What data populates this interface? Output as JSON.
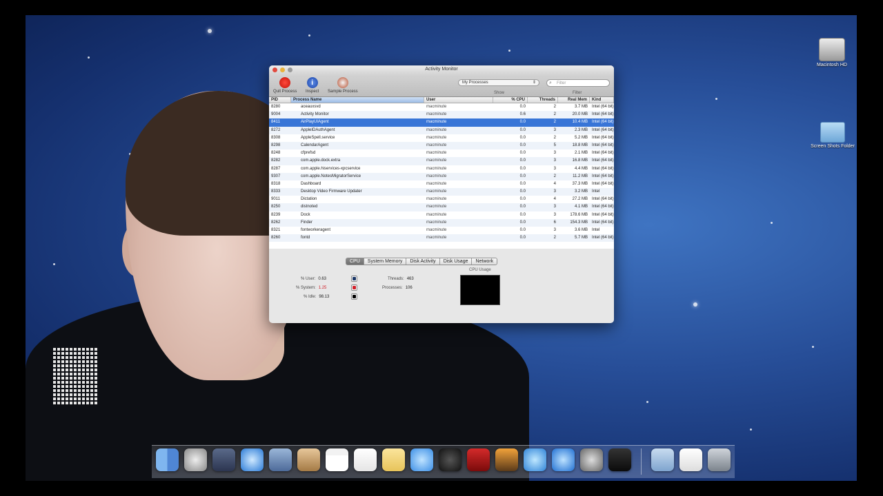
{
  "window": {
    "title": "Activity Monitor",
    "toolbar": {
      "quit_label": "Quit Process",
      "inspect_label": "Inspect",
      "sample_label": "Sample Process",
      "show_value": "My Processes",
      "show_caption": "Show",
      "filter_placeholder": "Filter",
      "filter_caption": "Filter"
    },
    "columns": [
      "PID",
      "Process Name",
      "User",
      "% CPU",
      "Threads",
      "Real Mem",
      "Kind"
    ],
    "rows": [
      {
        "pid": "8280",
        "name": "aceauxsvd",
        "user": "macminute",
        "cpu": "0.0",
        "threads": "2",
        "mem": "3.7 MB",
        "kind": "Intel (64 bit)"
      },
      {
        "pid": "9004",
        "name": "Activity Monitor",
        "user": "macminute",
        "cpu": "0.6",
        "threads": "2",
        "mem": "20.0 MB",
        "kind": "Intel (64 bit)"
      },
      {
        "pid": "8411",
        "name": "AirPlayUIAgent",
        "user": "macminute",
        "cpu": "0.0",
        "threads": "2",
        "mem": "10.4 MB",
        "kind": "Intel (64 bit)"
      },
      {
        "pid": "8272",
        "name": "AppleIDAuthAgent",
        "user": "macminute",
        "cpu": "0.0",
        "threads": "3",
        "mem": "2.3 MB",
        "kind": "Intel (64 bit)"
      },
      {
        "pid": "8308",
        "name": "AppleSpell.service",
        "user": "macminute",
        "cpu": "0.0",
        "threads": "2",
        "mem": "5.2 MB",
        "kind": "Intel (64 bit)"
      },
      {
        "pid": "8298",
        "name": "CalendarAgent",
        "user": "macminute",
        "cpu": "0.0",
        "threads": "5",
        "mem": "18.8 MB",
        "kind": "Intel (64 bit)"
      },
      {
        "pid": "8248",
        "name": "cfprefsd",
        "user": "macminute",
        "cpu": "0.0",
        "threads": "3",
        "mem": "2.1 MB",
        "kind": "Intel (64 bit)"
      },
      {
        "pid": "8282",
        "name": "com.apple.dock.extra",
        "user": "macminute",
        "cpu": "0.0",
        "threads": "3",
        "mem": "16.8 MB",
        "kind": "Intel (64 bit)"
      },
      {
        "pid": "8287",
        "name": "com.apple.hiservices-xpcservice",
        "user": "macminute",
        "cpu": "0.0",
        "threads": "3",
        "mem": "4.4 MB",
        "kind": "Intel (64 bit)"
      },
      {
        "pid": "9307",
        "name": "com.apple.NotesMigratorService",
        "user": "macminute",
        "cpu": "0.0",
        "threads": "2",
        "mem": "11.2 MB",
        "kind": "Intel (64 bit)"
      },
      {
        "pid": "8318",
        "name": "Dashboard",
        "user": "macminute",
        "cpu": "0.0",
        "threads": "4",
        "mem": "37.3 MB",
        "kind": "Intel (64 bit)"
      },
      {
        "pid": "8333",
        "name": "Desktop Video Firmware Updater",
        "user": "macminute",
        "cpu": "0.0",
        "threads": "3",
        "mem": "3.2 MB",
        "kind": "Intel"
      },
      {
        "pid": "9011",
        "name": "Dictation",
        "user": "macminute",
        "cpu": "0.0",
        "threads": "4",
        "mem": "27.2 MB",
        "kind": "Intel (64 bit)"
      },
      {
        "pid": "8250",
        "name": "distnoted",
        "user": "macminute",
        "cpu": "0.0",
        "threads": "3",
        "mem": "4.1 MB",
        "kind": "Intel (64 bit)"
      },
      {
        "pid": "8239",
        "name": "Dock",
        "user": "macminute",
        "cpu": "0.0",
        "threads": "3",
        "mem": "178.6 MB",
        "kind": "Intel (64 bit)"
      },
      {
        "pid": "8262",
        "name": "Finder",
        "user": "macminute",
        "cpu": "0.0",
        "threads": "6",
        "mem": "154.3 MB",
        "kind": "Intel (64 bit)"
      },
      {
        "pid": "8321",
        "name": "fontworkeragent",
        "user": "macminute",
        "cpu": "0.0",
        "threads": "3",
        "mem": "3.6 MB",
        "kind": "Intel"
      },
      {
        "pid": "8260",
        "name": "fontd",
        "user": "macminute",
        "cpu": "0.0",
        "threads": "2",
        "mem": "5.7 MB",
        "kind": "Intel (64 bit)"
      }
    ],
    "tabs": [
      "CPU",
      "System Memory",
      "Disk Activity",
      "Disk Usage",
      "Network"
    ],
    "cpu": {
      "user_label": "% User:",
      "user_value": "0.63",
      "system_label": "% System:",
      "system_value": "1.25",
      "idle_label": "% Idle:",
      "idle_value": "98.13",
      "threads_label": "Threads:",
      "threads_value": "463",
      "processes_label": "Processes:",
      "processes_value": "106",
      "graph_label": "CPU Usage",
      "colors": {
        "user": "#1c3766",
        "system": "#d0202a",
        "idle": "#000000"
      }
    }
  },
  "desktop": {
    "hdd_label": "Macintosh HD",
    "folder_label": "Screen Shots Folder"
  },
  "dock": {
    "items": [
      "finder-icon",
      "launchpad-icon",
      "mission-control-icon",
      "safari-icon",
      "mail-app-icon",
      "contacts-icon",
      "calendar-icon",
      "reminders-icon",
      "notes-icon",
      "messages-icon",
      "facetime-icon",
      "photo-booth-icon",
      "iphoto-icon",
      "itunes-icon",
      "app-store-icon",
      "system-preferences-icon",
      "activity-monitor-icon"
    ],
    "stack_items": [
      "applications-folder-icon",
      "documents-stack-icon",
      "trash-icon"
    ]
  }
}
